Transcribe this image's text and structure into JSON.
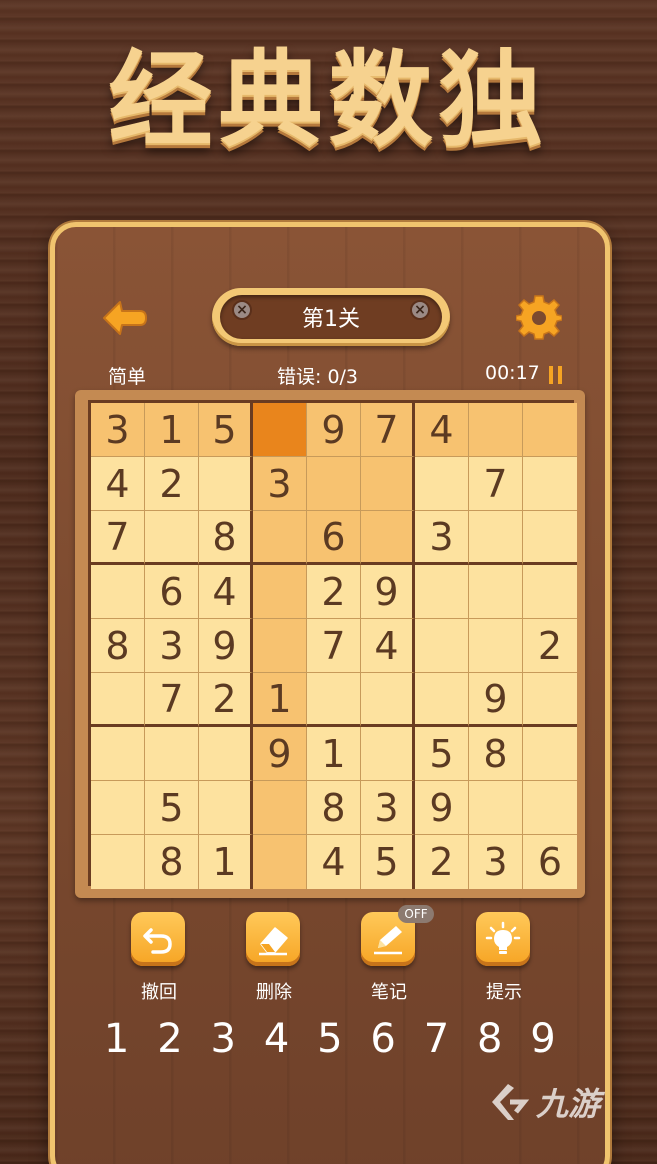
{
  "app_title": "经典数独",
  "header": {
    "level_label": "第1关",
    "back_icon": "arrow-left-icon",
    "settings_icon": "gear-icon"
  },
  "status": {
    "difficulty": "简单",
    "errors": "错误: 0/3",
    "timer": "00:17",
    "pause_icon": "pause-icon"
  },
  "board": {
    "cells": [
      [
        "3",
        "1",
        "5",
        "",
        "9",
        "7",
        "4",
        "",
        ""
      ],
      [
        "4",
        "2",
        "",
        "3",
        "",
        "",
        "",
        "7",
        ""
      ],
      [
        "7",
        "",
        "8",
        "",
        "6",
        "",
        "3",
        "",
        ""
      ],
      [
        "",
        "6",
        "4",
        "",
        "2",
        "9",
        "",
        "",
        ""
      ],
      [
        "8",
        "3",
        "9",
        "",
        "7",
        "4",
        "",
        "",
        "2"
      ],
      [
        "",
        "7",
        "2",
        "1",
        "",
        "",
        "",
        "9",
        ""
      ],
      [
        "",
        "",
        "",
        "9",
        "1",
        "",
        "5",
        "8",
        ""
      ],
      [
        "",
        "5",
        "",
        "",
        "8",
        "3",
        "9",
        "",
        ""
      ],
      [
        "",
        "8",
        "1",
        "",
        "4",
        "5",
        "2",
        "3",
        "6"
      ]
    ],
    "selected": {
      "row": 0,
      "col": 3
    },
    "colors": {
      "cell": "#fde29f",
      "highlight": "#f7c270",
      "selected": "#e9851c",
      "digit": "#5b3a22"
    }
  },
  "tools": [
    {
      "label": "撤回",
      "icon": "undo-icon"
    },
    {
      "label": "删除",
      "icon": "eraser-icon"
    },
    {
      "label": "笔记",
      "icon": "pencil-icon",
      "badge": "OFF"
    },
    {
      "label": "提示",
      "icon": "lightbulb-icon"
    }
  ],
  "numpad": [
    "1",
    "2",
    "3",
    "4",
    "5",
    "6",
    "7",
    "8",
    "9"
  ],
  "watermark": "九游"
}
